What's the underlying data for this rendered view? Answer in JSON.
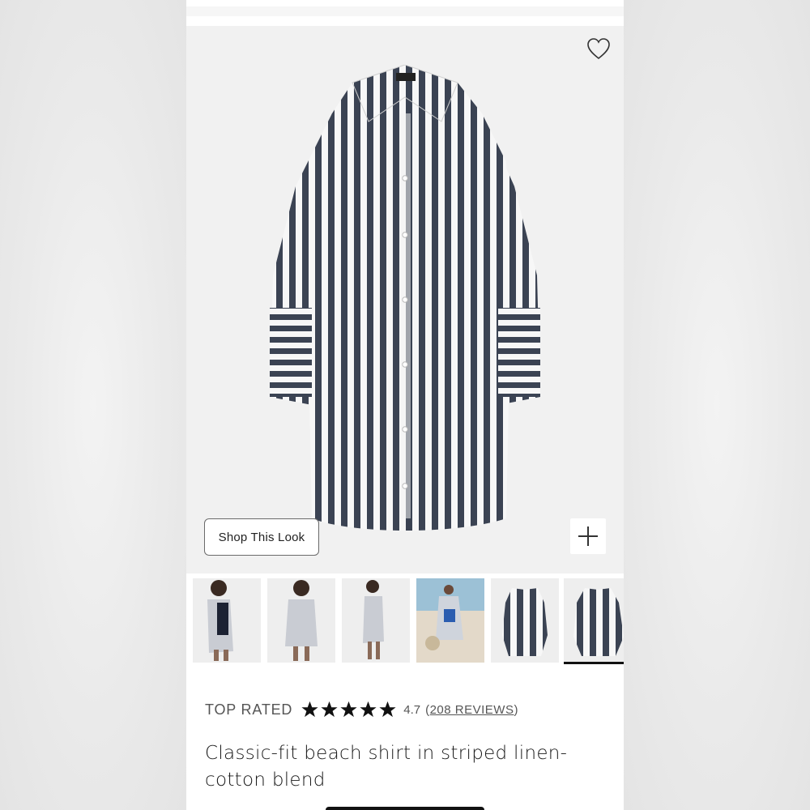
{
  "hero": {
    "shop_look_label": "Shop This Look",
    "wishlist_icon": "heart-outline-icon",
    "add_icon": "plus-icon",
    "collar_tag": "J.CREW"
  },
  "thumbnails": [
    {
      "name": "thumb-model-front-swimsuit",
      "active": false
    },
    {
      "name": "thumb-model-front",
      "active": false
    },
    {
      "name": "thumb-model-side",
      "active": false
    },
    {
      "name": "thumb-model-beach",
      "active": false
    },
    {
      "name": "thumb-flat-front",
      "active": false
    },
    {
      "name": "thumb-flat-angle",
      "active": true
    }
  ],
  "rating": {
    "badge": "TOP RATED",
    "stars": 5,
    "score": "4.7",
    "reviews_link": "208 REVIEWS",
    "open_paren": "(",
    "close_paren": ")"
  },
  "product": {
    "title_line1": "Classic-fit beach shirt in striped linen-",
    "title_line2": "cotton blend"
  },
  "colors": {
    "stripe": "#3b4353",
    "hero_bg": "#f1f1f1",
    "text": "#1a1a1a"
  }
}
